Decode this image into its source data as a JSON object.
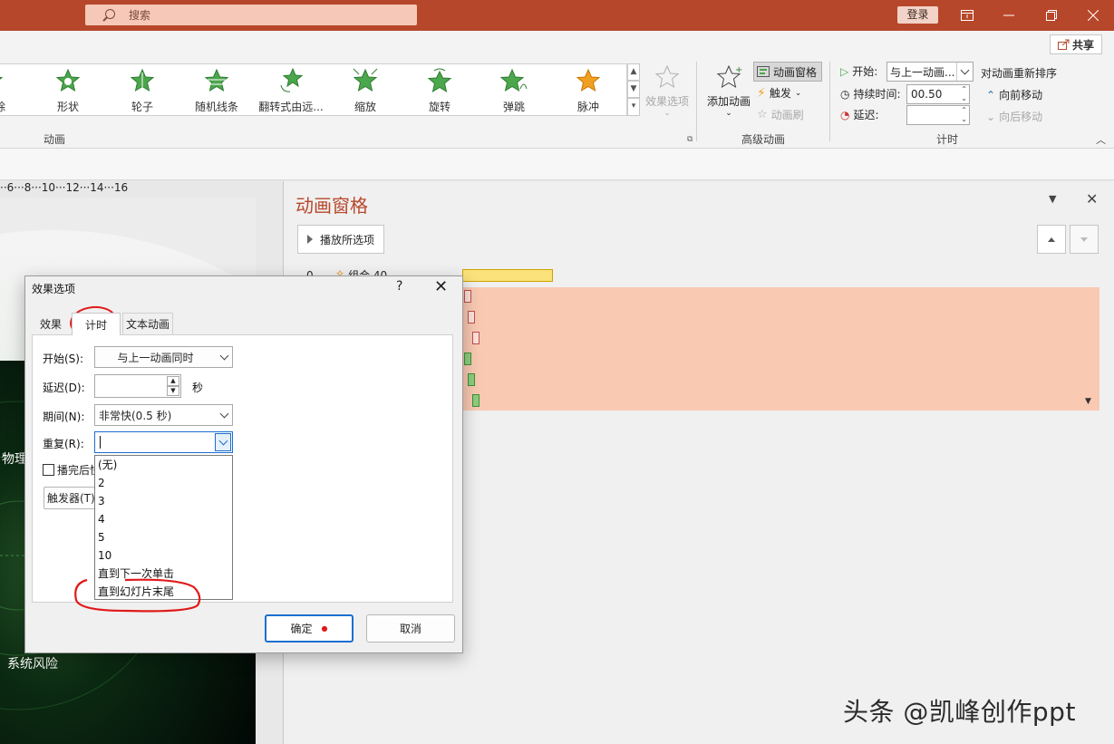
{
  "titlebar": {
    "search_placeholder": "搜索",
    "login": "登录"
  },
  "ribbon": {
    "share": "共享",
    "gallery_items": [
      "除",
      "形状",
      "轮子",
      "随机线条",
      "翻转式由远...",
      "缩放",
      "旋转",
      "弹跳",
      "脉冲"
    ],
    "effect_options": "效果选项",
    "group_animation": "动画",
    "group_advanced": "高级动画",
    "group_timing": "计时",
    "add_animation": "添加动画",
    "animation_pane": "动画窗格",
    "trigger": "触发",
    "animation_painter": "动画刷",
    "start_label": "开始:",
    "start_value": "与上一动画...",
    "duration_label": "持续时间:",
    "duration_value": "00.50",
    "delay_label": "延迟:",
    "reorder_title": "对动画重新排序",
    "move_earlier": "向前移动",
    "move_later": "向后移动"
  },
  "ruler": "··6···8···10···12···14···16",
  "slide": {
    "text1": "物理",
    "text2": "系统风险"
  },
  "pane": {
    "title": "动画窗格",
    "play_button": "播放所选项",
    "row0_number": "0",
    "row0_label": "组合 40"
  },
  "dialog": {
    "title": "效果选项",
    "help": "?",
    "tabs": [
      "效果",
      "计时",
      "文本动画"
    ],
    "start_label": "开始(S):",
    "start_value": "与上一动画同时",
    "delay_label": "延迟(D):",
    "delay_unit": "秒",
    "duration_label": "期间(N):",
    "duration_value": "非常快(0.5 秒)",
    "repeat_label": "重复(R):",
    "repeat_value": "",
    "rewind_label": "播完后快",
    "triggers_button": "触发器(T)",
    "repeat_options": [
      "(无)",
      "2",
      "3",
      "4",
      "5",
      "10",
      "直到下一次单击",
      "直到幻灯片末尾"
    ],
    "ok": "确定",
    "cancel": "取消"
  },
  "watermark": "头条 @凯峰创作ppt",
  "colors": {
    "accent": "#b7472a",
    "selection": "#f9c9b2",
    "star_green": "#4ca64c",
    "star_orange": "#f0a020",
    "red_mark": "#e01a1a"
  }
}
